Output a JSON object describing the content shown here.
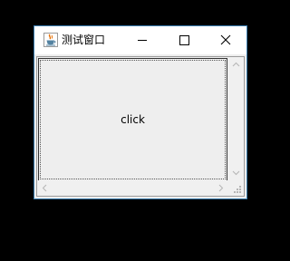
{
  "window": {
    "title": "测试窗口",
    "icon": "java-cup-icon",
    "controls": {
      "minimize": "minimize-icon",
      "maximize": "maximize-icon",
      "close": "close-icon"
    }
  },
  "content": {
    "button_label": "click"
  },
  "colors": {
    "desktop": "#000000",
    "window_border": "#3c7fb1",
    "panel": "#eeeeee",
    "java_orange": "#e76f00",
    "java_blue": "#5382a1"
  }
}
